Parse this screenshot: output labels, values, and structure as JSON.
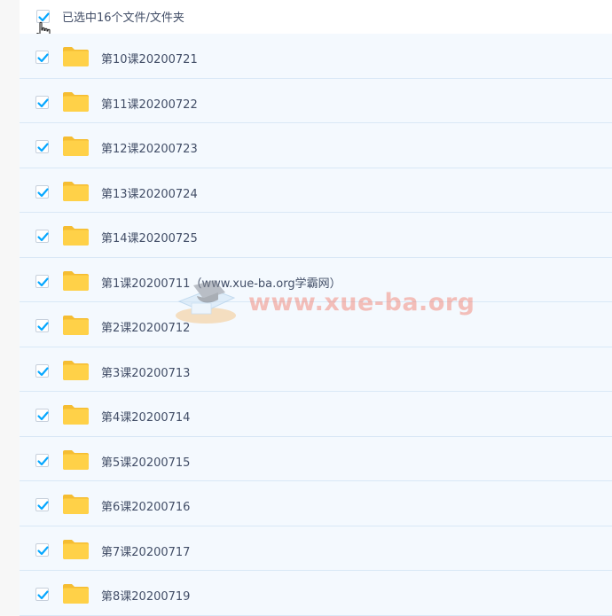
{
  "header": {
    "selection_text": "已选中16个文件/文件夹"
  },
  "colors": {
    "accent": "#06a7ff",
    "folder": "#ffd148",
    "row_bg": "#f4f9fe",
    "row_border": "#d9e8f6"
  },
  "files": [
    {
      "name": "第10课20200721",
      "checked": true,
      "icon": "folder-icon"
    },
    {
      "name": "第11课20200722",
      "checked": true,
      "icon": "folder-icon"
    },
    {
      "name": "第12课20200723",
      "checked": true,
      "icon": "folder-icon"
    },
    {
      "name": "第13课20200724",
      "checked": true,
      "icon": "folder-icon"
    },
    {
      "name": "第14课20200725",
      "checked": true,
      "icon": "folder-icon"
    },
    {
      "name": "第1课20200711（www.xue-ba.org学霸网）",
      "checked": true,
      "icon": "folder-icon"
    },
    {
      "name": "第2课20200712",
      "checked": true,
      "icon": "folder-icon"
    },
    {
      "name": "第3课20200713",
      "checked": true,
      "icon": "folder-icon"
    },
    {
      "name": "第4课20200714",
      "checked": true,
      "icon": "folder-icon"
    },
    {
      "name": "第5课20200715",
      "checked": true,
      "icon": "folder-icon"
    },
    {
      "name": "第6课20200716",
      "checked": true,
      "icon": "folder-icon"
    },
    {
      "name": "第7课20200717",
      "checked": true,
      "icon": "folder-icon"
    },
    {
      "name": "第8课20200719",
      "checked": true,
      "icon": "folder-icon"
    }
  ],
  "watermark": {
    "text": "www.xue-ba.org"
  }
}
